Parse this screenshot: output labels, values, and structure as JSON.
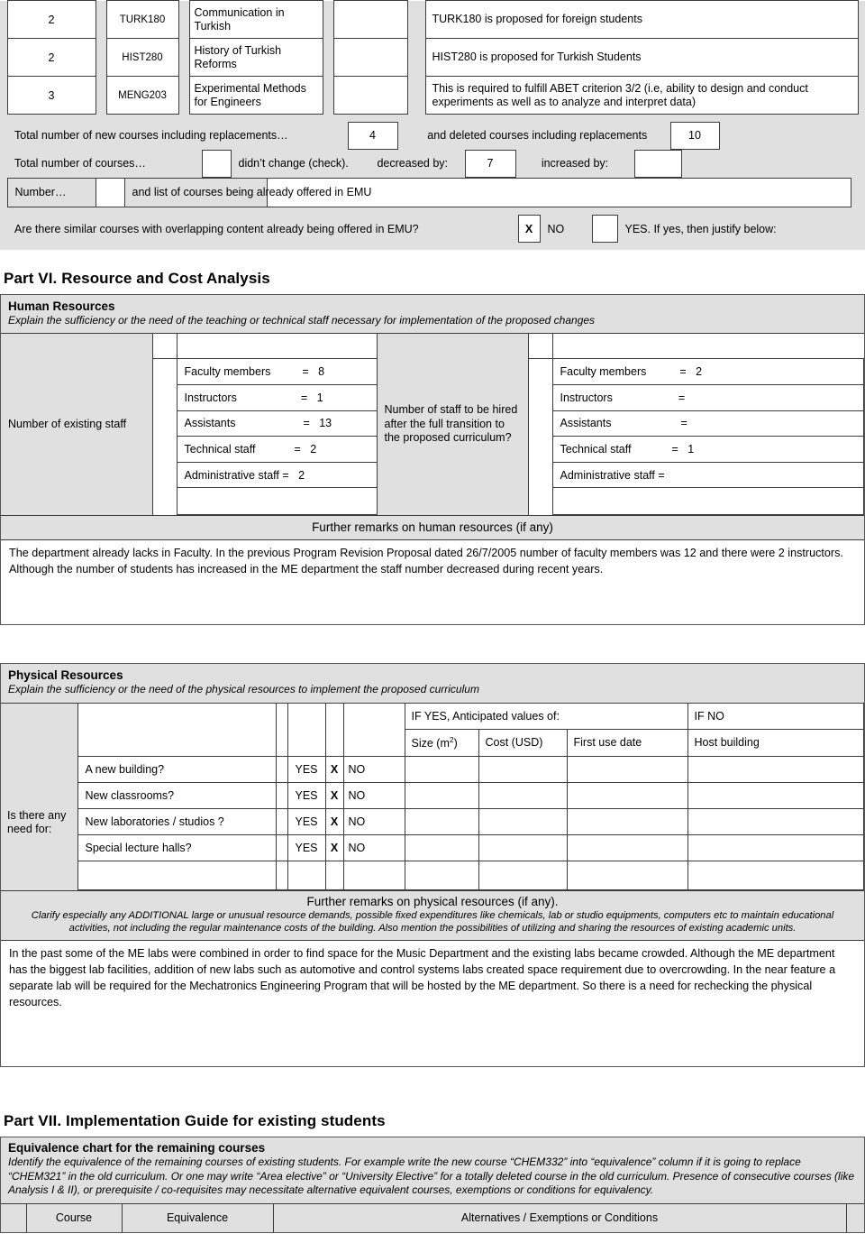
{
  "colors": {
    "panel_gray": "#e0e0e0",
    "border": "#3c3c3c",
    "frame": "#555555",
    "text": "#000000"
  },
  "new_courses_table": {
    "rows": [
      {
        "credits": "2",
        "code": "TURK180",
        "name": "Communication in Turkish",
        "blank": "",
        "note": "TURK180 is proposed for foreign students"
      },
      {
        "credits": "2",
        "code": "HIST280",
        "name": "History of Turkish Reforms",
        "blank": "",
        "note": "HIST280 is proposed for Turkish Students"
      },
      {
        "credits": "3",
        "code": "MENG203",
        "name": "Experimental Methods for Engineers",
        "blank": "",
        "note": "This is required to fulfill ABET criterion 3/2 (i.e, ability to design and conduct experiments as well as to analyze and interpret data)"
      }
    ]
  },
  "counts": {
    "new_label": "Total number of new courses including replacements…",
    "new_value": "4",
    "deleted_label": "and deleted courses including replacements",
    "deleted_value": "10",
    "total_label": "Total number of courses…",
    "nochange_check": "",
    "nochange_label": "didn’t change (check).",
    "decreased_label": "decreased by:",
    "decreased_value": "7",
    "increased_label": "increased by:",
    "increased_value": "",
    "number_label": "Number…",
    "number_value": "",
    "already_offered_label": "and list of courses being already offered in EMU",
    "already_offered_value": ""
  },
  "overlap": {
    "question": "Are there similar courses with overlapping content already being offered in EMU?",
    "no_mark": "X",
    "no_label": "NO",
    "yes_mark": "",
    "yes_label": "YES. If yes, then justify below:"
  },
  "part6": {
    "heading": "Part VI.  Resource and Cost Analysis",
    "human": {
      "title": "Human Resources",
      "subtitle": "Explain the sufficiency or the need of the teaching or technical staff necessary for implementation of the proposed changes",
      "existing_label": "Number of existing staff",
      "hire_label": "Number of staff to be hired after the full transition to the proposed curriculum?",
      "existing_rows": [
        {
          "label": "Faculty members",
          "eq": "=",
          "value": "8"
        },
        {
          "label": "Instructors",
          "eq": "=",
          "value": "1"
        },
        {
          "label": "Assistants",
          "eq": "=",
          "value": "13"
        },
        {
          "label": "Technical staff",
          "eq": "=",
          "value": "2"
        },
        {
          "label": "Administrative staff =",
          "eq": "",
          "value": "2"
        },
        {
          "label": "",
          "eq": "",
          "value": ""
        }
      ],
      "hire_rows": [
        {
          "label": "Faculty members",
          "eq": "=",
          "value": "2"
        },
        {
          "label": "Instructors",
          "eq": "=",
          "value": ""
        },
        {
          "label": "Assistants",
          "eq": "=",
          "value": ""
        },
        {
          "label": "Technical staff",
          "eq": "=",
          "value": "1"
        },
        {
          "label": "Administrative staff =",
          "eq": "",
          "value": ""
        },
        {
          "label": "",
          "eq": "",
          "value": ""
        }
      ],
      "remarks_header": "Further remarks on human resources (if any)",
      "remarks_text": "The department already lacks in Faculty.   In the previous Program Revision Proposal dated 26/7/2005 number of faculty members was 12 and there were 2 instructors.   Although the number of students has increased in the ME department the staff number decreased during recent years."
    },
    "physical": {
      "title": "Physical Resources",
      "subtitle": "Explain the sufficiency or the need of the physical resources to implement the proposed curriculum",
      "need_label": "Is there any need for:",
      "ifyes_header": "IF YES, Anticipated values of:",
      "ifno_header": "IF NO",
      "col_size": "Size (m",
      "col_size_sup": "2",
      "col_size_end": ")",
      "col_cost": "Cost (USD)",
      "col_firstuse": "First use date",
      "col_host": "Host building",
      "rows": [
        {
          "question": "A new building?",
          "yes": "YES",
          "mark": "X",
          "no": "NO",
          "size": "",
          "cost": "",
          "firstuse": "",
          "host": ""
        },
        {
          "question": "New classrooms?",
          "yes": "YES",
          "mark": "X",
          "no": "NO",
          "size": "",
          "cost": "",
          "firstuse": "",
          "host": ""
        },
        {
          "question": "New laboratories / studios ?",
          "yes": "YES",
          "mark": "X",
          "no": "NO",
          "size": "",
          "cost": "",
          "firstuse": "",
          "host": ""
        },
        {
          "question": "Special lecture halls?",
          "yes": "YES",
          "mark": "X",
          "no": "NO",
          "size": "",
          "cost": "",
          "firstuse": "",
          "host": ""
        },
        {
          "question": "",
          "yes": "",
          "mark": "",
          "no": "",
          "size": "",
          "cost": "",
          "firstuse": "",
          "host": ""
        }
      ],
      "remarks_header": "Further remarks on physical resources (if any).",
      "remarks_sub": "Clarify especially any ADDITIONAL large or unusual resource demands, possible fixed expenditures like chemicals, lab or studio equipments, computers etc to maintain educational activities, not including the regular maintenance costs of the building. Also mention the possibilities of utilizing and sharing the resources of existing academic units.",
      "remarks_text": "In the past some of the ME labs were combined in order to find space for the Music Department and the existing labs became crowded.   Although the ME department has the biggest lab facilities, addition of new labs such as automotive and control systems labs created space requirement due to overcrowding.    In the near feature a separate lab will be required for the Mechatronics Engineering Program that will be hosted by the ME department.   So there is a need for rechecking the physical resources."
    }
  },
  "part7": {
    "heading": "Part VII. Implementation Guide for existing students",
    "title": "Equivalence chart for the remaining courses",
    "subtitle": "Identify the equivalence of the remaining courses of existing students. For example write the new course “CHEM332” into “equivalence” column if it is going to replace “CHEM321” in the old curriculum. Or one may write “Area elective” or “University Elective” for a totally deleted course in the old curriculum. Presence of consecutive courses (like Analysis I & II), or prerequisite / co-requisites may necessitate alternative equivalent courses, exemptions or conditions for equivalency.",
    "columns": [
      "Course",
      "Equivalence",
      "Alternatives / Exemptions or Conditions"
    ]
  }
}
